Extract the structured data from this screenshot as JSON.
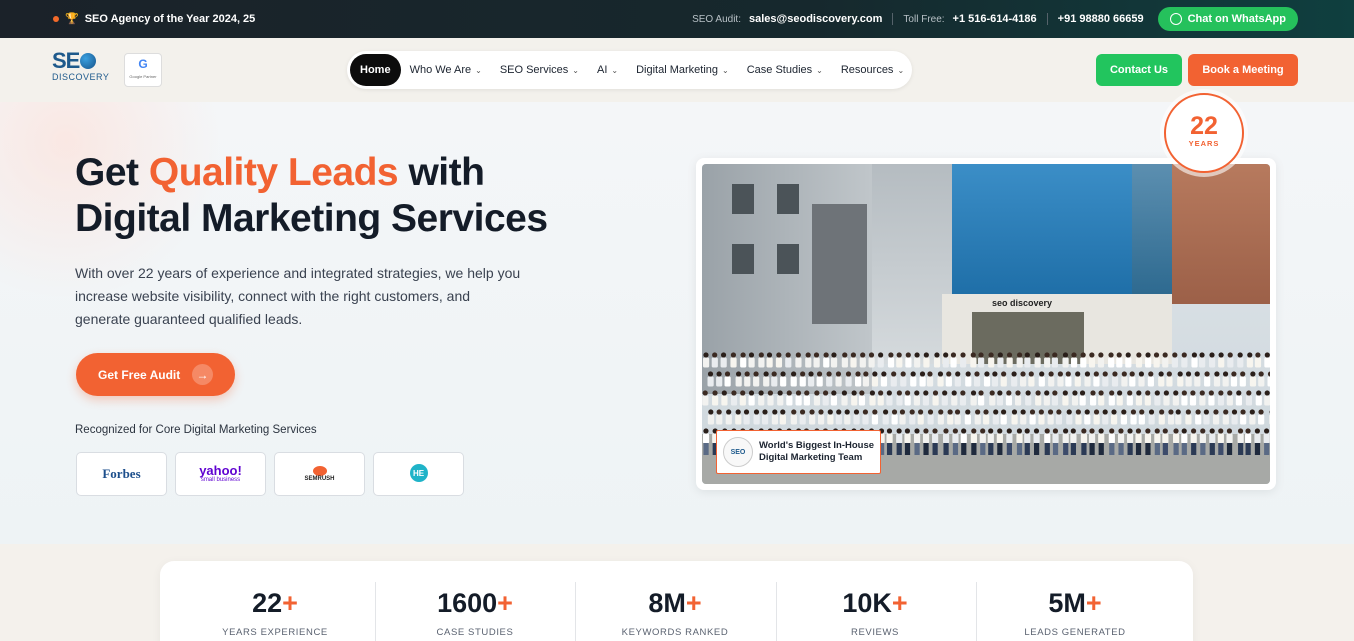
{
  "topbar": {
    "award": "SEO Agency of the Year 2024, 25",
    "audit_label": "SEO Audit:",
    "audit_email": "sales@seodiscovery.com",
    "tollfree_label": "Toll Free:",
    "tollfree_number": "+1 516-614-4186",
    "phone": "+91 98880 66659",
    "whatsapp": "Chat on WhatsApp"
  },
  "header": {
    "logo_seo": "SE",
    "logo_discovery": "DISCOVERY",
    "google_badge_letter": "G",
    "google_badge_text": "Google Partner",
    "nav": [
      {
        "label": "Home",
        "dropdown": false
      },
      {
        "label": "Who We Are",
        "dropdown": true
      },
      {
        "label": "SEO Services",
        "dropdown": true
      },
      {
        "label": "AI",
        "dropdown": true
      },
      {
        "label": "Digital Marketing",
        "dropdown": true
      },
      {
        "label": "Case Studies",
        "dropdown": true
      },
      {
        "label": "Resources",
        "dropdown": true
      }
    ],
    "contact_button": "Contact Us",
    "book_button": "Book a Meeting"
  },
  "hero": {
    "title_pre": "Get ",
    "title_accent": "Quality Leads",
    "title_post": " with",
    "title_line2": "Digital Marketing Services",
    "lead": "With over 22 years of experience and integrated strategies, we help you increase website visibility, connect with the right customers, and generate guaranteed qualified leads.",
    "cta": "Get Free Audit",
    "recognized": "Recognized for Core Digital Marketing Services",
    "badges": {
      "forbes": "Forbes",
      "yahoo": "yahoo!",
      "yahoo_sub": "small business",
      "semrush": "SEMRUSH",
      "hm": "HE"
    },
    "photo_sign": "seo discovery",
    "years_num": "22",
    "years_label": "YEARS",
    "team_logo": "SEO",
    "team_text_1": "World's Biggest In-House",
    "team_text_2": "Digital Marketing Team"
  },
  "stats": [
    {
      "value": "22",
      "suffix": "+",
      "label": "Years Experience"
    },
    {
      "value": "1600",
      "suffix": "+",
      "label": "Case Studies"
    },
    {
      "value": "8M",
      "suffix": "+",
      "label": "Keywords Ranked"
    },
    {
      "value": "10K",
      "suffix": "+",
      "label": "Reviews"
    },
    {
      "value": "5M",
      "suffix": "+",
      "label": "Leads Generated"
    }
  ],
  "colors": {
    "accent": "#f26232",
    "green": "#22c55e",
    "dark": "#141c28"
  }
}
